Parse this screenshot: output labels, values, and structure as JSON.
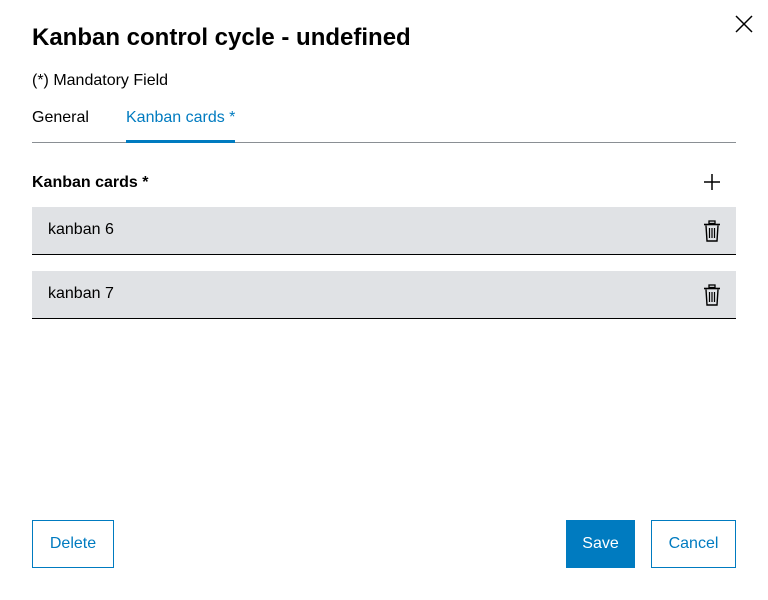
{
  "dialog": {
    "title": "Kanban control cycle - undefined",
    "mandatory_note": "(*) Mandatory Field",
    "close_icon": "close-icon"
  },
  "tabs": [
    {
      "label": "General",
      "active": false
    },
    {
      "label": "Kanban cards *",
      "active": true
    }
  ],
  "section": {
    "title": "Kanban cards *",
    "add_icon": "plus-icon"
  },
  "cards": [
    {
      "label": "kanban 6",
      "action_icon": "trash-icon"
    },
    {
      "label": "kanban 7",
      "action_icon": "trash-icon"
    }
  ],
  "footer": {
    "delete_label": "Delete",
    "save_label": "Save",
    "cancel_label": "Cancel"
  },
  "colors": {
    "accent": "#007bc0",
    "row_background": "#e0e2e5",
    "divider": "#8a8f94"
  }
}
